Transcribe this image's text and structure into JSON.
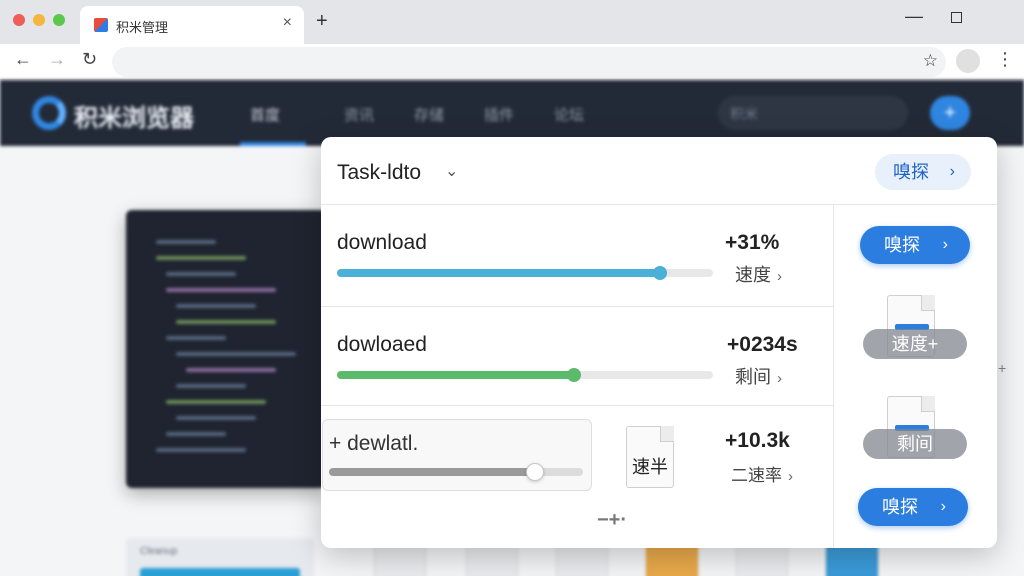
{
  "browser": {
    "tab_title": "积米管理",
    "tab_close": "×",
    "new_tab": "+",
    "back": "←",
    "forward": "→",
    "reload": "↻",
    "star": "☆",
    "menu": "⋮",
    "minimize": "—"
  },
  "site": {
    "logo": "积米浏览器",
    "nav": [
      "首度",
      "资讯",
      "存储",
      "插件",
      "论坛"
    ],
    "search_placeholder": "积米",
    "plus": "+",
    "bottom_card_label": "Cleanup"
  },
  "panel": {
    "title": "Task-ldto",
    "title_chevron": "⌄",
    "header_action": "嗅探",
    "rows": [
      {
        "label": "download",
        "value": "+31%",
        "sub": "速度",
        "progress": 0.86,
        "color": "#4ab0d8"
      },
      {
        "label": "dowloaed",
        "value": "+0234s",
        "sub": "剩间",
        "progress": 0.63,
        "color": "#5cbb6a"
      },
      {
        "label": "+ dewlatl.",
        "value": "+10.3k",
        "sub": "二速率",
        "progress": 0.81,
        "color": "#9a9a9a"
      }
    ],
    "doc_label": "速半",
    "mini_controls": "−+·",
    "side_actions": {
      "top": "嗅探",
      "doc1_label": "速度+",
      "doc2_label": "剩间",
      "bottom": "嗅探"
    },
    "arrow": "›"
  },
  "colors": {
    "accent": "#2b7de0",
    "header_dark": "#232a37",
    "progress_teal": "#4ab0d8",
    "progress_green": "#5cbb6a"
  },
  "icons": [
    "close-icon",
    "plus-icon",
    "back-icon",
    "forward-icon",
    "reload-icon",
    "star-icon",
    "menu-icon",
    "chevron-down-icon",
    "chevron-right-icon",
    "document-icon"
  ]
}
